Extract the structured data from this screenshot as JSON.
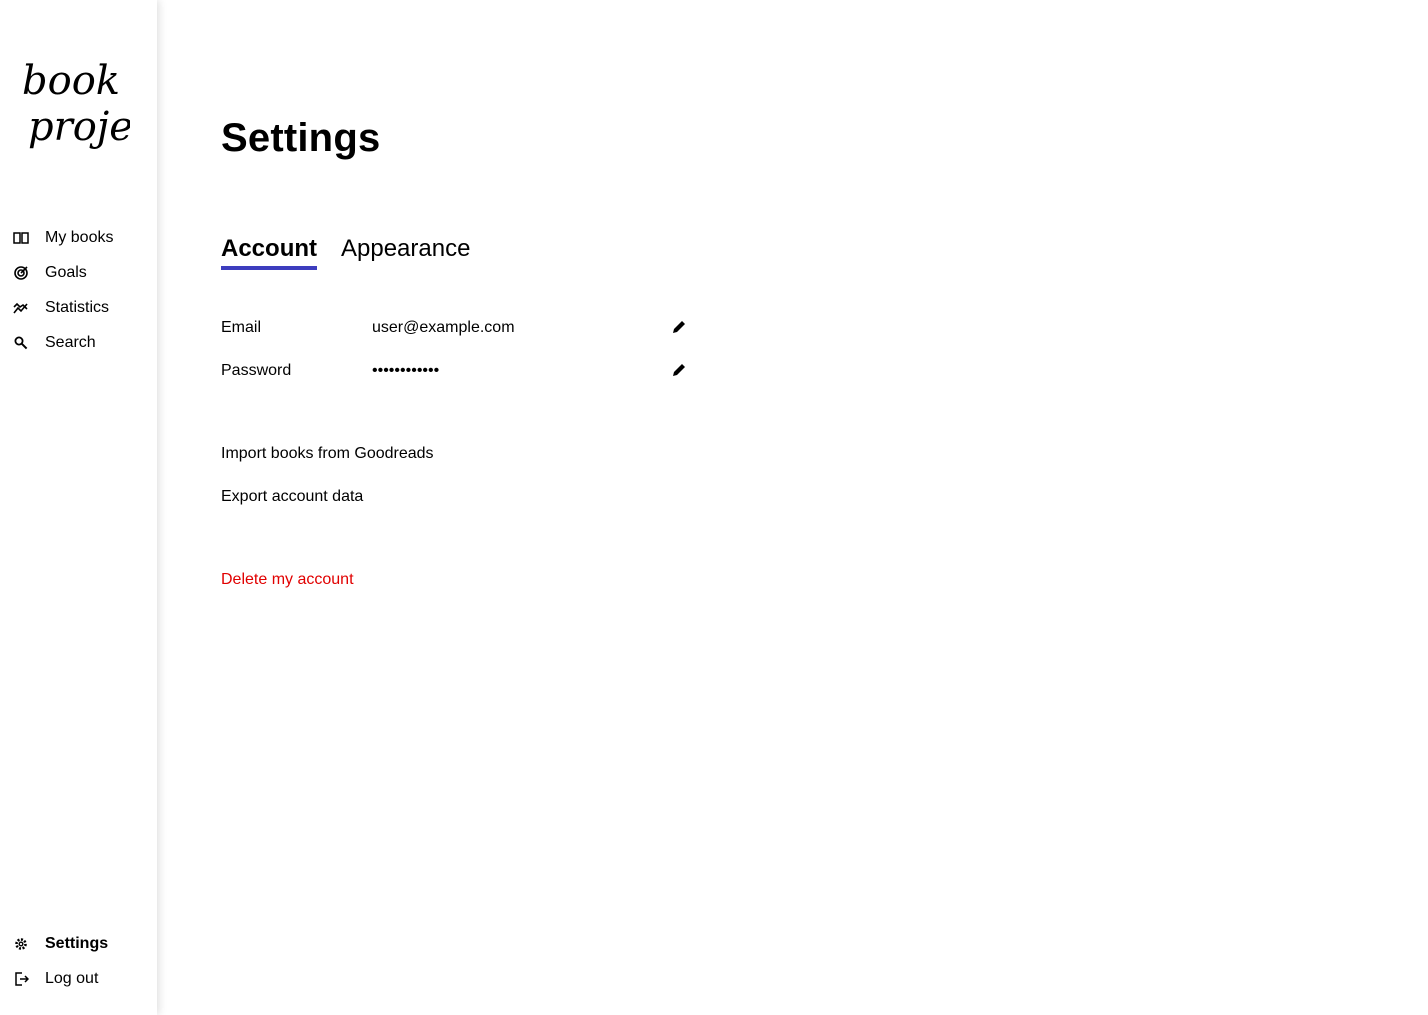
{
  "app": {
    "logo_line1": "book",
    "logo_line2": "project"
  },
  "sidebar": {
    "items": [
      {
        "label": "My books",
        "icon": "book-open-icon"
      },
      {
        "label": "Goals",
        "icon": "target-icon"
      },
      {
        "label": "Statistics",
        "icon": "stats-icon"
      },
      {
        "label": "Search",
        "icon": "search-icon"
      }
    ],
    "bottom_items": [
      {
        "label": "Settings",
        "icon": "gear-icon",
        "active": true
      },
      {
        "label": "Log out",
        "icon": "logout-icon"
      }
    ]
  },
  "main": {
    "title": "Settings",
    "tabs": [
      {
        "label": "Account",
        "active": true
      },
      {
        "label": "Appearance",
        "active": false
      }
    ],
    "fields": {
      "email": {
        "label": "Email",
        "value": "user@example.com"
      },
      "password": {
        "label": "Password",
        "value": "••••••••••••"
      }
    },
    "actions": {
      "import": "Import books from Goodreads",
      "export": "Export account data",
      "delete": "Delete my account"
    }
  },
  "colors": {
    "accent": "#3d3dbe",
    "danger": "#e10000"
  }
}
